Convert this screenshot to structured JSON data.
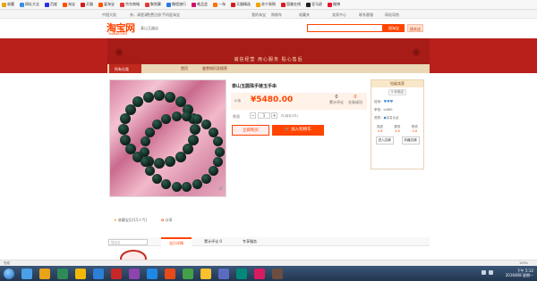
{
  "favorites": [
    {
      "label": "收藏",
      "color": "#e8a316"
    },
    {
      "label": "网址大全",
      "color": "#3a8ee6"
    },
    {
      "label": "百度",
      "color": "#2932e1"
    },
    {
      "label": "淘宝",
      "color": "#ff5000"
    },
    {
      "label": "天猫",
      "color": "#d11c1c"
    },
    {
      "label": "爱淘宝",
      "color": "#ff5000"
    },
    {
      "label": "京东商城",
      "color": "#e4393c"
    },
    {
      "label": "聚划算",
      "color": "#e4393c"
    },
    {
      "label": "携程旅行",
      "color": "#2a7ae2"
    },
    {
      "label": "唯品会",
      "color": "#d1146b"
    },
    {
      "label": "一淘",
      "color": "#ff7300"
    },
    {
      "label": "天猫精选",
      "color": "#d11c1c"
    },
    {
      "label": "苏宁易购",
      "color": "#f0a30a"
    },
    {
      "label": "国美在线",
      "color": "#d91b1b"
    },
    {
      "label": "亚马逊",
      "color": "#222"
    },
    {
      "label": "微博",
      "color": "#e6162d"
    }
  ],
  "topnav": {
    "region": "中国大陆",
    "login": "亲，请登录",
    "register": "免费注册",
    "mobile": "手机逛淘宝",
    "my_taobao": "我的淘宝",
    "cart": "购物车",
    "favorites": "收藏夹",
    "seller_center": "卖家中心",
    "contact": "联系客服",
    "sitemap": "网站导航"
  },
  "header": {
    "logo": "淘宝网",
    "logo_sub": "Taobao.com",
    "shop_name": "泰山玉器店",
    "search_placeholder": "",
    "search_button": "搜淘宝",
    "search_shop_button": "搜本店"
  },
  "banner": {
    "slogan": "诚信经营  用心服务  贴心售后",
    "subnav_category": "所有分类",
    "subnav_home": "首页",
    "subnav_knowledge": "鉴赏知识及保养"
  },
  "product": {
    "title": "泰山玉圆珠手链玉手串",
    "price_label": "价格",
    "price": "¥5480.00",
    "reviews_count": "0",
    "reviews_label": "累计评论",
    "sales_count": "0",
    "sales_label": "交易成功",
    "qty_label": "数量",
    "qty": "1",
    "stock": "件(库存2件)",
    "buy_label": "立即购买",
    "cart_label": "加入购物车",
    "share_fav": "收藏宝贝(15人气)",
    "share": "分享"
  },
  "seller": {
    "header": "钻级卖家",
    "years": "5 年老店",
    "credit_label": "信用：",
    "hearts": "♥♥♥",
    "name_label": "掌柜：",
    "name": "tc880",
    "qual_label": "资质：",
    "qual": "实名认证",
    "score_labels": [
      "描述",
      "服务",
      "物流"
    ],
    "score_values": [
      "4.8",
      "4.8",
      "4.8"
    ],
    "enter_shop": "进入店铺",
    "fav_shop": "收藏店铺"
  },
  "tabs": {
    "search_placeholder": "搜全店",
    "items": [
      "宝贝详情",
      "累计评论 0",
      "专享服务"
    ]
  },
  "statusbar": {
    "left": "完成",
    "zoom": "100%"
  },
  "taskbar": {
    "time": "下午 5:12",
    "date": "2016/8/8 星期一",
    "apps": [
      {
        "color": "#4aa0e6"
      },
      {
        "color": "#e8a316"
      },
      {
        "color": "#2e8b57"
      },
      {
        "color": "#f2b705"
      },
      {
        "color": "#2b7fd6"
      },
      {
        "color": "#c62828"
      },
      {
        "color": "#8e44ad"
      },
      {
        "color": "#1e88e5"
      },
      {
        "color": "#e64a19"
      },
      {
        "color": "#43a047"
      },
      {
        "color": "#fbc02d"
      },
      {
        "color": "#5c6bc0"
      },
      {
        "color": "#00897b"
      },
      {
        "color": "#d81b60"
      },
      {
        "color": "#6d4c41"
      }
    ]
  }
}
